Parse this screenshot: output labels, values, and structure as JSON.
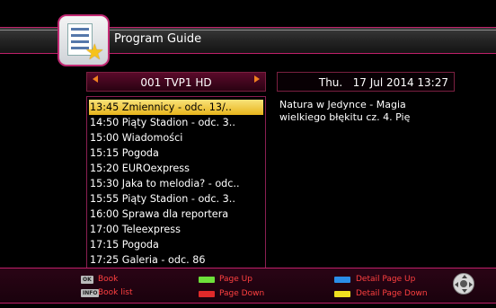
{
  "header": {
    "title": "Program Guide",
    "icon": "program-guide-icon"
  },
  "channel": {
    "label": "001 TVP1 HD"
  },
  "datetime": "Thu.   17 Jul 2014 13:27",
  "programs": [
    {
      "text": "13:45  Zmiennicy - odc. 13/..",
      "selected": true
    },
    {
      "text": "14:50  Piąty Stadion - odc. 3..",
      "selected": false
    },
    {
      "text": "15:00  Wiadomości",
      "selected": false
    },
    {
      "text": "15:15  Pogoda",
      "selected": false
    },
    {
      "text": "15:20  EUROexpress",
      "selected": false
    },
    {
      "text": "15:30  Jaka to melodia? - odc..",
      "selected": false
    },
    {
      "text": "15:55  Piąty Stadion - odc. 3..",
      "selected": false
    },
    {
      "text": "16:00  Sprawa dla reportera",
      "selected": false
    },
    {
      "text": "17:00  Teleexpress",
      "selected": false
    },
    {
      "text": "17:15  Pogoda",
      "selected": false
    },
    {
      "text": "17:25  Galeria - odc. 86",
      "selected": false
    }
  ],
  "detail": "Natura w Jedynce  - Magia\nwielkiego błękitu cz. 4. Pię",
  "legend": {
    "ok_key": "OK",
    "book": "Book",
    "info_key": "INFO",
    "book_list": "Book list",
    "page_up": "Page Up",
    "page_down": "Page Down",
    "detail_page_up": "Detail Page Up",
    "detail_page_down": "Detail Page Down"
  },
  "colors": {
    "accent": "#c0206a",
    "selected_row": "#f0c840",
    "green_key": "#6ee03a",
    "red_key": "#e02a2a",
    "blue_key": "#2a8ee8",
    "yellow_key": "#f0e020",
    "legend_text": "#ff4040"
  }
}
